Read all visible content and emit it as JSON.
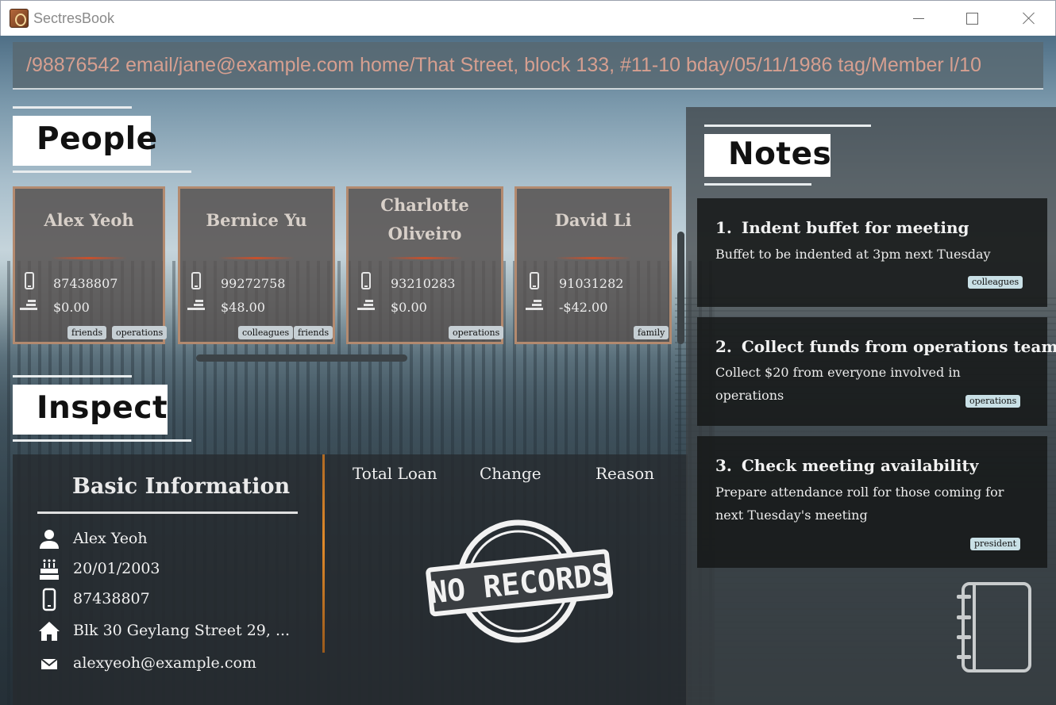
{
  "window": {
    "title": "SectresBook"
  },
  "command_box": {
    "value": "/98876542 email/jane@example.com home/That Street, block 133, #11-10 bday/05/11/1986 tag/Member l/10"
  },
  "sections": {
    "people": "People",
    "inspect": "Inspect",
    "notes": "Notes"
  },
  "people": [
    {
      "name_line1": "Alex Yeoh",
      "name_line2": "",
      "phone": "87438807",
      "loan": "$0.00",
      "tags": [
        "friends",
        "operations"
      ]
    },
    {
      "name_line1": "Bernice Yu",
      "name_line2": "",
      "phone": "99272758",
      "loan": "$48.00",
      "tags": [
        "colleagues",
        "friends"
      ]
    },
    {
      "name_line1": "Charlotte",
      "name_line2": "Oliveiro",
      "phone": "93210283",
      "loan": "$0.00",
      "tags": [
        "operations"
      ]
    },
    {
      "name_line1": "David Li",
      "name_line2": "",
      "phone": "91031282",
      "loan": "-$42.00",
      "tags": [
        "family"
      ]
    }
  ],
  "inspect": {
    "heading": "Basic Information",
    "name": "Alex Yeoh",
    "birthday": "20/01/2003",
    "phone": "87438807",
    "address": "Blk 30 Geylang Street 29, ...",
    "email": "alexyeoh@example.com",
    "columns": [
      "Total Loan",
      "Change",
      "Reason"
    ],
    "empty_stamp": "NO RECORDS"
  },
  "notes": [
    {
      "number": "1.",
      "title": "Indent buffet for meeting",
      "body": "Buffet to be indented at 3pm next Tuesday",
      "tag": "colleagues"
    },
    {
      "number": "2.",
      "title": "Collect funds from operations team",
      "body": "Collect $20 from everyone involved in operations",
      "tag": "operations"
    },
    {
      "number": "3.",
      "title": "Check meeting availability",
      "body": "Prepare attendance roll for those coming for next Tuesday's meeting",
      "tag": "president"
    }
  ],
  "icons": {
    "card_phone": "phone-icon",
    "card_loan": "hand-money-icon",
    "inspect_name": "person-icon",
    "inspect_birthday": "birthday-cake-icon",
    "inspect_phone": "phone-icon",
    "inspect_address": "home-icon",
    "inspect_email": "mail-icon",
    "notes_decoration": "notebook-icon"
  },
  "colors": {
    "card_border": "#b38a6f",
    "accent_divider": "#c8502c",
    "command_text": "#d69f90",
    "tag_bg": "#c6cfd4"
  }
}
